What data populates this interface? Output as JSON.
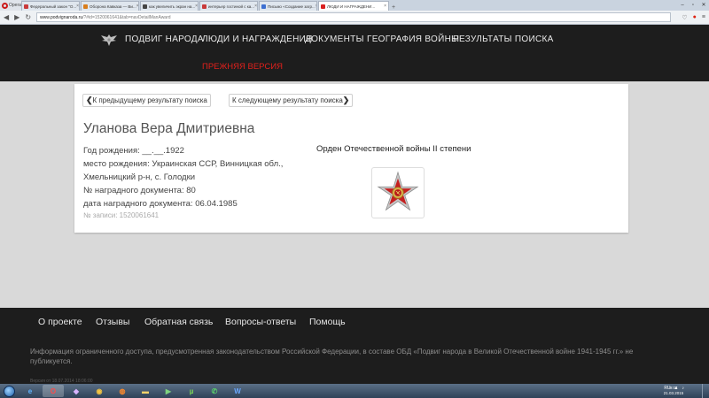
{
  "browser": {
    "menu_label": "Opera",
    "tabs": [
      {
        "label": "Федеральный закон \"О...",
        "favicon_color": "#c93a3a"
      },
      {
        "label": "Оборона Кавказа — Ви...",
        "favicon_color": "#d97d1c"
      },
      {
        "label": "как увеличить экран на...",
        "favicon_color": "#444444"
      },
      {
        "label": "интерьер гостиной с ка...",
        "favicon_color": "#c93a3a"
      },
      {
        "label": "Письмо «Создание загр...",
        "favicon_color": "#3d6fd1"
      },
      {
        "label": "ЛЮДИ И НАГРАЖДЕНИ...",
        "favicon_color": "#d92020"
      }
    ],
    "url_host": "www.podvignaroda.ru",
    "url_path": "/?#id=1520061641&tab=navDetailManAward",
    "new_tab": "+",
    "win_min": "–",
    "win_max": "▫",
    "win_close": "✕"
  },
  "header": {
    "nav": [
      {
        "label": "ПОДВИГ НАРОДА"
      },
      {
        "label": "ЛЮДИ И НАГРАЖДЕНИЯ"
      },
      {
        "label": "ДОКУМЕНТЫ"
      },
      {
        "label": "ГЕОГРАФИЯ ВОЙНЫ"
      },
      {
        "label": "РЕЗУЛЬТАТЫ ПОИСКА"
      }
    ],
    "old_version": "ПРЕЖНЯЯ ВЕРСИЯ",
    "accent": "#e0201c"
  },
  "card": {
    "prev_label": "К предыдущему результату поиска",
    "next_label": "К следующему результату поиска",
    "name": "Уланова Вера Дмитриевна",
    "fields": [
      "Год рождения: __.__.1922",
      "место рождения: Украинская ССР, Винницкая обл., Хмельницкий р-н, с. Голодки",
      "№ наградного документа: 80",
      "дата наградного документа: 06.04.1985"
    ],
    "record_id": "№ записи: 1520061641",
    "award_title": "Орден Отечественной войны II степени"
  },
  "footer": {
    "links": [
      {
        "label": "О проекте"
      },
      {
        "label": "Отзывы"
      },
      {
        "label": "Обратная связь"
      },
      {
        "label": "Вопросы-ответы"
      },
      {
        "label": "Помощь"
      }
    ],
    "note": "Информация ограниченного доступа, предусмотренная законодательством Российской Федерации, в составе ОБД «Подвиг народа в Великой Отечественной войне 1941-1945 гг.» не публикуется.",
    "version": "Версия от 18.07.2014 18:06:00"
  },
  "taskbar": {
    "lang": "RU",
    "time": "9:07",
    "date": "21.03.2015"
  }
}
